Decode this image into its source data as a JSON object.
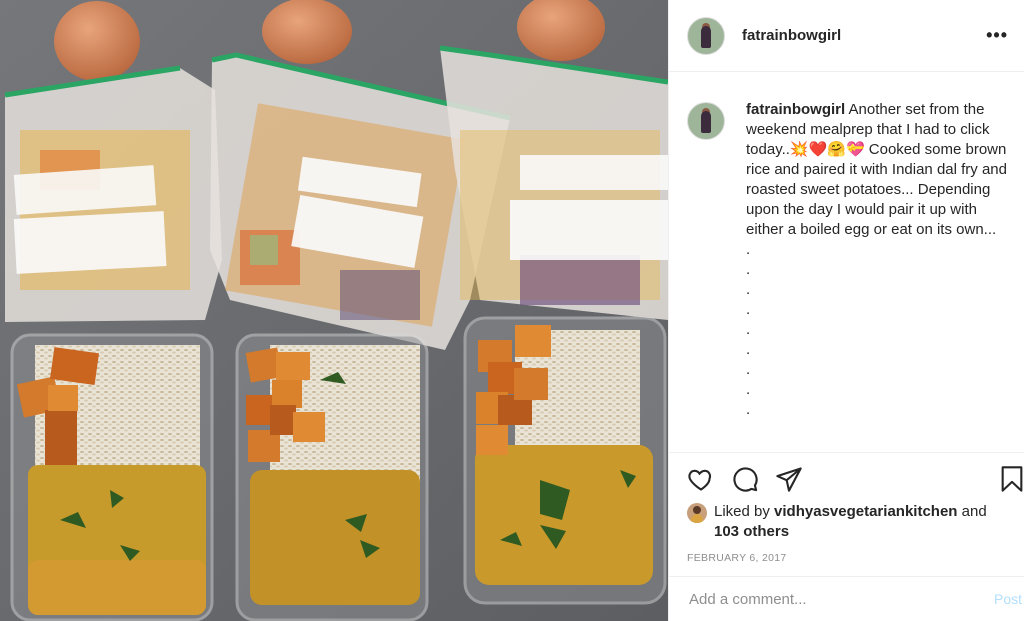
{
  "post": {
    "username": "fatrainbowgirl",
    "more_label": "•••",
    "caption_text": "Another set from the weekend mealprep that I had to click today..💥❤️🤗💝 Cooked some brown rice and paired it with Indian dal fry and roasted sweet potatoes... Depending upon the day I would pair it up with either a boiled egg or eat on its own...",
    "caption_dots": [
      ".",
      ".",
      ".",
      ".",
      ".",
      ".",
      ".",
      ".",
      "."
    ],
    "liked_by_prefix": "Liked by",
    "liked_by_user": "vidhyasvegetariankitchen",
    "liked_by_and": "and",
    "liked_by_others": "103 others",
    "date": "February 6, 2017",
    "comment_placeholder": "Add a comment...",
    "post_button": "Post"
  },
  "icons": {
    "like": "heart-icon",
    "comment": "comment-icon",
    "share": "share-icon",
    "save": "bookmark-icon",
    "more": "more-icon"
  },
  "colors": {
    "text": "#262626",
    "secondary": "#8e8e8e",
    "post_disabled": "#b2dffc",
    "border": "#efefef"
  }
}
